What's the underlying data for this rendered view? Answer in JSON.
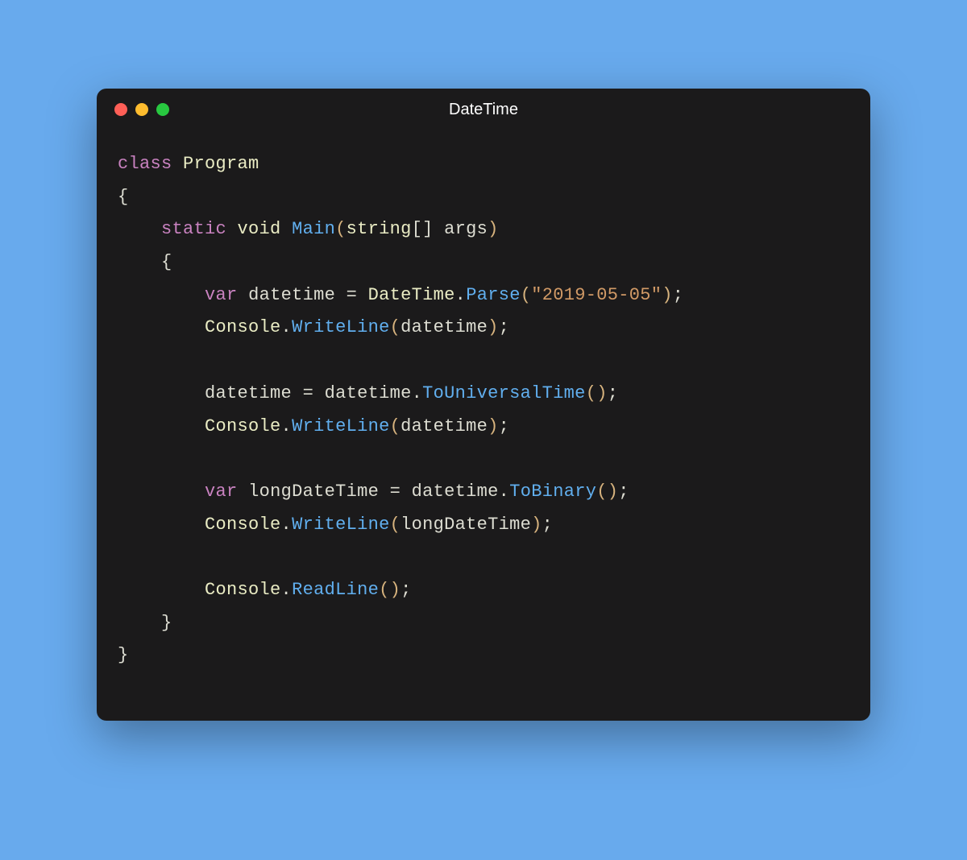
{
  "window": {
    "title": "DateTime"
  },
  "code": {
    "tokens": {
      "kw_class": "class",
      "kw_static": "static",
      "kw_var1": "var",
      "kw_var2": "var",
      "rt_void": "void",
      "cn_program": "Program",
      "ty_string": "string",
      "ty_datetime": "DateTime",
      "ty_console1": "Console",
      "ty_console2": "Console",
      "ty_console3": "Console",
      "ty_console4": "Console",
      "m_main": "Main",
      "m_parse": "Parse",
      "m_writeline1": "WriteLine",
      "m_writeline2": "WriteLine",
      "m_writeline3": "WriteLine",
      "m_touniversal": "ToUniversalTime",
      "m_tobinary": "ToBinary",
      "m_readline": "ReadLine",
      "id_args": "args",
      "id_datetime1": "datetime",
      "id_datetime2": "datetime",
      "id_datetime3": "datetime",
      "id_datetime4": "datetime",
      "id_datetime5": "datetime",
      "id_datetime6": "datetime",
      "id_longdatetime1": "longDateTime",
      "id_longdatetime2": "longDateTime",
      "str_date": "\"2019-05-05\"",
      "p_lbrace1": "{",
      "p_rbrace1": "}",
      "p_lbrace2": "{",
      "p_rbrace2": "}",
      "p_lbracket": "[]",
      "p_lparen": "(",
      "p_rparen": ")",
      "p_dot": ".",
      "p_semi": ";",
      "p_eq": "=",
      "p_space": " "
    }
  }
}
